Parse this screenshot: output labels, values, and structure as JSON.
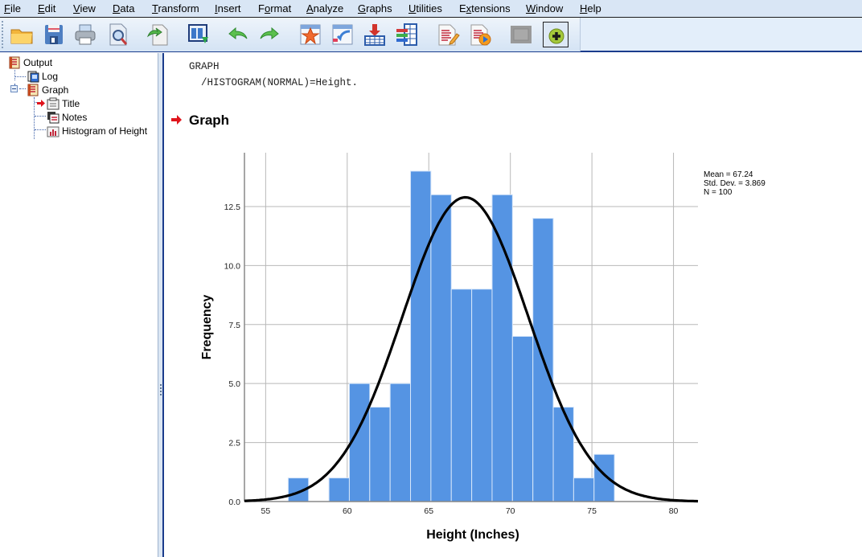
{
  "menubar": {
    "items": [
      {
        "label": "File",
        "ul": "F",
        "rest": "ile"
      },
      {
        "label": "Edit",
        "ul": "E",
        "rest": "dit"
      },
      {
        "label": "View",
        "ul": "V",
        "rest": "iew"
      },
      {
        "label": "Data",
        "ul": "D",
        "rest": "ata"
      },
      {
        "label": "Transform",
        "ul": "T",
        "rest": "ransform"
      },
      {
        "label": "Insert",
        "ul": "I",
        "rest": "nsert"
      },
      {
        "label": "Format",
        "pre": "F",
        "ul": "o",
        "rest": "rmat"
      },
      {
        "label": "Analyze",
        "ul": "A",
        "rest": "nalyze"
      },
      {
        "label": "Graphs",
        "ul": "G",
        "rest": "raphs"
      },
      {
        "label": "Utilities",
        "ul": "U",
        "rest": "tilities"
      },
      {
        "label": "Extensions",
        "pre": "E",
        "ul": "x",
        "rest": "tensions"
      },
      {
        "label": "Window",
        "ul": "W",
        "rest": "indow"
      },
      {
        "label": "Help",
        "ul": "H",
        "rest": "elp"
      }
    ]
  },
  "toolbar": {
    "buttons": [
      {
        "icon": "open-folder-icon",
        "tooltip": "Open"
      },
      {
        "icon": "save-icon",
        "tooltip": "Save"
      },
      {
        "icon": "print-icon",
        "tooltip": "Print"
      },
      {
        "icon": "print-preview-icon",
        "tooltip": "Print Preview"
      },
      {
        "icon": "export-icon",
        "tooltip": "Export"
      },
      {
        "icon": "recall-dialog-icon",
        "tooltip": "Recall recently used dialogs"
      },
      {
        "icon": "undo-icon",
        "tooltip": "Undo"
      },
      {
        "icon": "redo-icon",
        "tooltip": "Redo"
      },
      {
        "icon": "goto-data-icon",
        "tooltip": "Go to data"
      },
      {
        "icon": "goto-case-icon",
        "tooltip": "Go to case"
      },
      {
        "icon": "insert-cases-icon",
        "tooltip": "Insert cases"
      },
      {
        "icon": "variables-icon",
        "tooltip": "Variables"
      },
      {
        "icon": "edit-output-icon",
        "tooltip": "Edit"
      },
      {
        "icon": "play-output-icon",
        "tooltip": "Run"
      },
      {
        "icon": "disabled-button-icon",
        "tooltip": ""
      },
      {
        "icon": "add-icon",
        "tooltip": "Add"
      }
    ]
  },
  "outline": {
    "items": [
      {
        "label": "Output",
        "icon": "output-book-icon"
      },
      {
        "label": "Log",
        "icon": "log-icon"
      },
      {
        "label": "Graph",
        "icon": "output-book-icon"
      },
      {
        "label": "Title",
        "icon": "title-icon",
        "selected": true
      },
      {
        "label": "Notes",
        "icon": "notes-icon"
      },
      {
        "label": "Histogram of Height",
        "icon": "histogram-icon"
      }
    ]
  },
  "content": {
    "syntax_line1": "GRAPH",
    "syntax_line2": "  /HISTOGRAM(NORMAL)=Height.",
    "heading": "Graph"
  },
  "colors": {
    "bar_fill": "#5594e3",
    "curve": "#000000",
    "grid": "#b8b8b8",
    "arrow": "#e0141c"
  },
  "chart_data": {
    "type": "bar",
    "subtype": "histogram-with-normal-curve",
    "title": "",
    "xlabel": "Height (Inches)",
    "ylabel": "Frequency",
    "bin_start": 56.38,
    "bin_width": 1.25,
    "counts": [
      1,
      0,
      1,
      5,
      4,
      5,
      14,
      13,
      9,
      9,
      13,
      7,
      12,
      4,
      1,
      2
    ],
    "xlim": [
      53.7,
      81.5
    ],
    "ylim": [
      0,
      14.78
    ],
    "xticks": [
      55,
      60,
      65,
      70,
      75,
      80
    ],
    "xtick_labels": [
      "55",
      "60",
      "65",
      "70",
      "75",
      "80"
    ],
    "yticks": [
      0,
      2.5,
      5,
      7.5,
      10,
      12.5
    ],
    "ytick_labels": [
      "0.0",
      "2.5",
      "5.0",
      "7.5",
      "10.0",
      "12.5"
    ],
    "grid": true,
    "normal_curve": {
      "mean": 67.24,
      "sd": 3.869,
      "n": 100
    },
    "stats_text": [
      "Mean = 67.24",
      "Std. Dev. = 3.869",
      "N = 100"
    ],
    "stats_placement": "top-right"
  }
}
